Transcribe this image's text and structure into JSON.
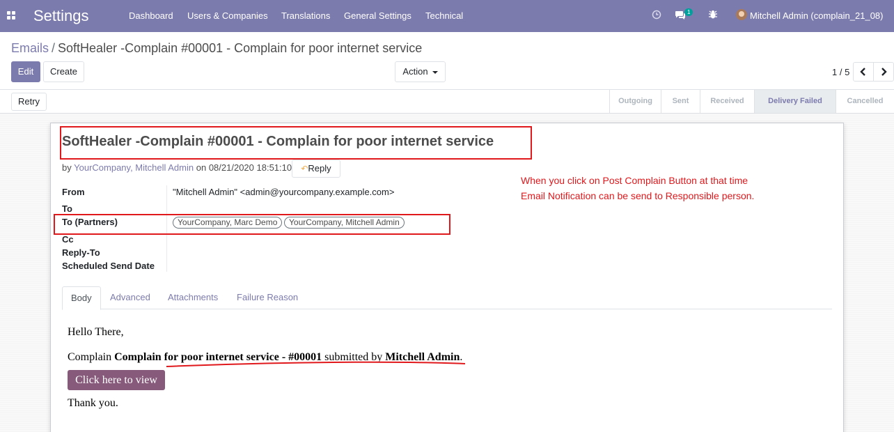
{
  "navbar": {
    "brand": "Settings",
    "menu": [
      "Dashboard",
      "Users & Companies",
      "Translations",
      "General Settings",
      "Technical"
    ],
    "notification_count": "1",
    "user": "Mitchell Admin (complain_21_08)",
    "icons": [
      "apps-icon",
      "clock-icon",
      "chat-icon",
      "bug-icon"
    ]
  },
  "breadcrumb": {
    "parent": "Emails",
    "separator": "/",
    "current": "SoftHealer -Complain #00001 - Complain for poor internet service"
  },
  "buttons": {
    "edit": "Edit",
    "create": "Create",
    "action": "Action",
    "retry": "Retry",
    "reply": "Reply",
    "view": "Click here to view"
  },
  "pager": {
    "value": "1 / 5"
  },
  "stages": [
    {
      "label": "Outgoing",
      "active": false
    },
    {
      "label": "Sent",
      "active": false
    },
    {
      "label": "Received",
      "active": false
    },
    {
      "label": "Delivery Failed",
      "active": true
    },
    {
      "label": "Cancelled",
      "active": false
    }
  ],
  "message": {
    "subject": "SoftHealer -Complain #00001 - Complain for poor internet service",
    "by": "by",
    "authors": "YourCompany, Mitchell Admin",
    "on": "on",
    "date": "08/21/2020 18:51:10"
  },
  "fields": {
    "from_label": "From",
    "from_value": "\"Mitchell Admin\" <admin@yourcompany.example.com>",
    "to_label": "To",
    "to_partners_label": "To (Partners)",
    "partners": [
      "YourCompany, Marc Demo",
      "YourCompany, Mitchell Admin"
    ],
    "cc_label": "Cc",
    "reply_to_label": "Reply-To",
    "scheduled_label": "Scheduled Send Date"
  },
  "annotation": {
    "line1": "When you click on Post Complain Button at that time",
    "line2": "Email Notification can be send to Responsible person."
  },
  "tabs": [
    "Body",
    "Advanced",
    "Attachments",
    "Failure Reason"
  ],
  "body": {
    "greeting": "Hello There,",
    "complain_prefix": "Complain ",
    "complain_title": "Complain for poor internet service - #00001",
    "submitted_by": " submitted by ",
    "submitter": "Mitchell Admin",
    "period": ".",
    "closing": "Thank you."
  },
  "colors": {
    "primary": "#7c7bad",
    "annotation": "#e0181c",
    "view_button": "#875a7b"
  }
}
